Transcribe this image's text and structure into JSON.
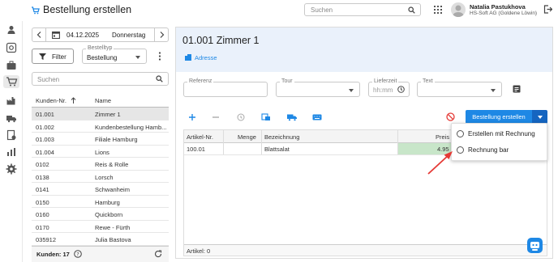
{
  "app": {
    "title": "Bestellung erstellen",
    "search_placeholder": "Suchen",
    "user_name": "Natalia Pastukhova",
    "user_company": "HS-Soft AG (Goldene Löwin)"
  },
  "date_nav": {
    "date": "04.12.2025",
    "weekday": "Donnerstag"
  },
  "filters": {
    "filter_label": "Filter",
    "order_type_label": "Bestelltyp",
    "order_type_value": "Bestellung",
    "search_placeholder": "Suchen"
  },
  "customer_table": {
    "col_number": "Kunden-Nr.",
    "col_name": "Name",
    "rows": [
      {
        "nr": "01.001",
        "name": "Zimmer 1"
      },
      {
        "nr": "01.002",
        "name": "Kundenbestellung Hamb..."
      },
      {
        "nr": "01.003",
        "name": "Filiale Hamburg"
      },
      {
        "nr": "01.004",
        "name": "Lions"
      },
      {
        "nr": "0102",
        "name": "Reis & Rolle"
      },
      {
        "nr": "0138",
        "name": "Lorsch"
      },
      {
        "nr": "0141",
        "name": "Schwanheim"
      },
      {
        "nr": "0150",
        "name": "Hamburg"
      },
      {
        "nr": "0160",
        "name": "Quickborn"
      },
      {
        "nr": "0170",
        "name": "Rewe - Fürth"
      },
      {
        "nr": "035912",
        "name": "Julia Bastova"
      }
    ],
    "footer_count": "Kunden: 17"
  },
  "order": {
    "title": "01.001 Zimmer 1",
    "address_link": "Adresse",
    "ref_label": "Referenz",
    "tour_label": "Tour",
    "delivery_label": "Lieferzeit",
    "delivery_placeholder": "hh:mm",
    "text_label": "Text",
    "create_button": "Bestellung erstellen",
    "grid_cols": {
      "article": "Artikel-Nr.",
      "qty": "Menge",
      "desc": "Bezeichnung",
      "price": "Preis"
    },
    "grid_rows": [
      {
        "article": "100.01",
        "qty": "",
        "desc": "Blattsalat",
        "price": "4.95"
      }
    ],
    "footer": "Artikel: 0"
  },
  "popup": {
    "options": [
      "Erstellen mit Rechnung",
      "Rechnung bar"
    ]
  },
  "colors": {
    "accent": "#1e88e5",
    "price_cell": "#c8e6c9",
    "arrow": "#e53935",
    "header_bg": "#eaf1fb"
  }
}
